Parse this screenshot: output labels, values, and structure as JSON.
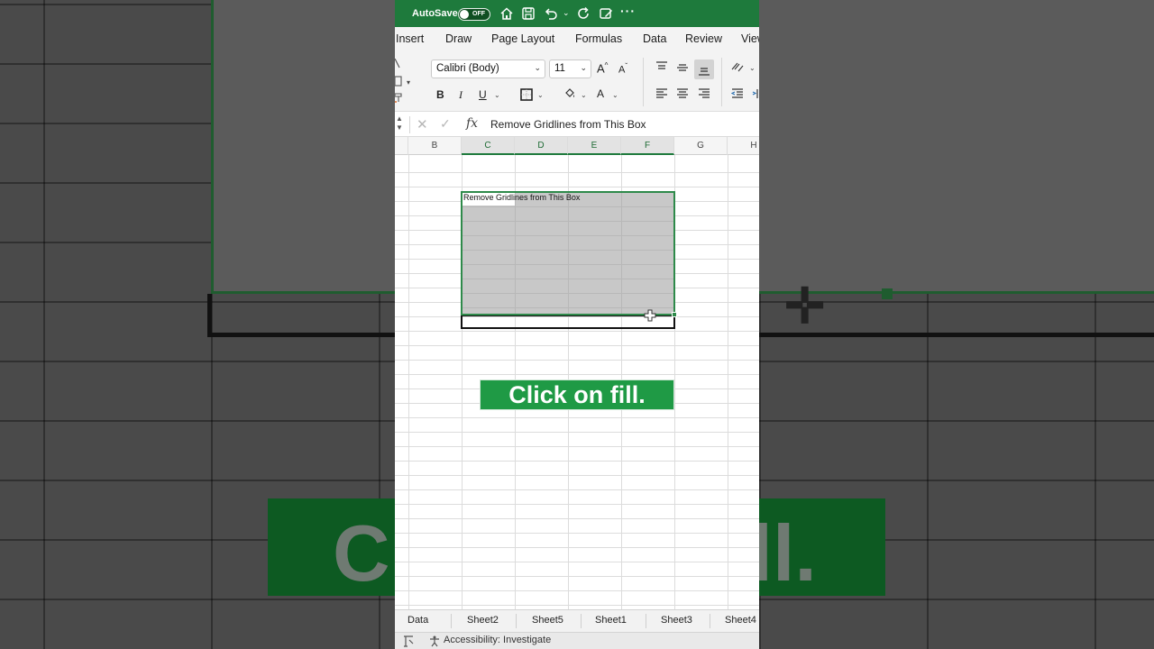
{
  "titlebar": {
    "autosave_label": "AutoSave",
    "autosave_state": "OFF",
    "icons": [
      "home-icon",
      "save-icon",
      "undo-icon",
      "redo-icon",
      "edit-icon",
      "more-icon"
    ],
    "more": "···"
  },
  "menu": {
    "items": [
      "Insert",
      "Draw",
      "Page Layout",
      "Formulas",
      "Data",
      "Review",
      "View"
    ]
  },
  "ribbon": {
    "font_name": "Calibri (Body)",
    "font_size": "11",
    "grow_font": "A",
    "shrink_font": "A",
    "bold": "B",
    "italic": "I",
    "underline": "U",
    "font_color": "A"
  },
  "formula_bar": {
    "value": "Remove Gridlines from This Box"
  },
  "columns": [
    "B",
    "C",
    "D",
    "E",
    "F",
    "G",
    "H"
  ],
  "cell": {
    "text": "Remove Gridlines from This Box"
  },
  "banner": {
    "text": "Click on fill.",
    "background_text": "Click on fill."
  },
  "sheet_tabs": [
    "Data",
    "Sheet2",
    "Sheet5",
    "Sheet1",
    "Sheet3",
    "Sheet4"
  ],
  "status": {
    "accessibility": "Accessibility: Investigate"
  },
  "colors": {
    "excel_green": "#1e7a3c",
    "banner_green": "#1f9a45",
    "selection_fill": "#c8c8c8"
  }
}
